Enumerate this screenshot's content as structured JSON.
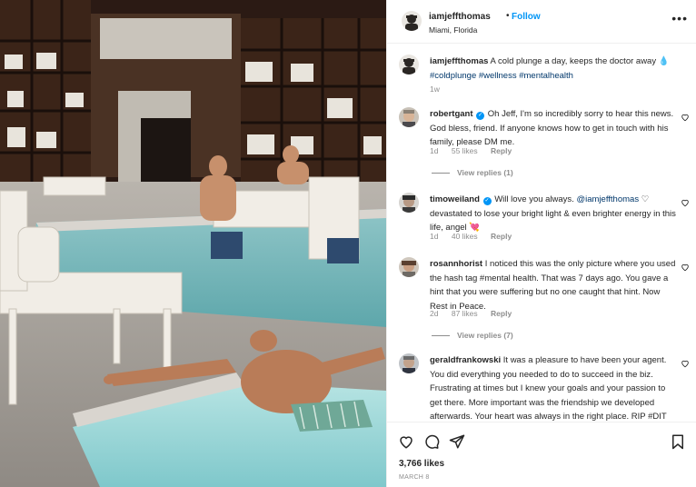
{
  "post": {
    "author": "iamjeffthomas",
    "follow_label": "Follow",
    "location": "Miami, Florida",
    "more_icon": "more-horizontal-icon"
  },
  "caption": {
    "username": "iamjeffthomas",
    "text": "A cold plunge a day, keeps the doctor away",
    "emoji": "💧",
    "hashtags": "#coldplunge #wellness #mentalhealth",
    "time": "1w"
  },
  "comments": [
    {
      "username": "robertgant",
      "verified": true,
      "text": "Oh Jeff, I'm so incredibly sorry to hear this news. God bless, friend. If anyone knows how to get in touch with his family, please DM me.",
      "time": "1d",
      "likes": "55 likes",
      "reply": "Reply",
      "view_replies": "View replies (1)"
    },
    {
      "username": "timoweiland",
      "verified": true,
      "text_before": "Will love you always.",
      "mention": "@iamjeffthomas",
      "emoji1": "♡",
      "text_after": "devastated to lose your bright light & even brighter energy in this life, angel",
      "emoji2": "💘",
      "time": "1d",
      "likes": "40 likes",
      "reply": "Reply"
    },
    {
      "username": "rosannhorist",
      "verified": false,
      "text": "I noticed this was the only picture where you used the hash tag #mental health. That was 7 days ago. You gave a hint that you were suffering but no one caught that hint. Now Rest in Peace.",
      "time": "2d",
      "likes": "87 likes",
      "reply": "Reply",
      "view_replies": "View replies (7)"
    },
    {
      "username": "geraldfrankowski",
      "verified": false,
      "text": "It was a pleasure to have been your agent. You did everything you needed to do to succeed in the biz. Frustrating at times but I knew your goals and your passion to get there. More important was the friendship we developed afterwards. Your heart was always in the right place. RIP #DIT"
    }
  ],
  "footer": {
    "likes": "3,766 likes",
    "date": "MARCH 8",
    "icons": [
      "heart-icon",
      "comment-icon",
      "share-icon",
      "bookmark-icon"
    ]
  },
  "colors": {
    "accent": "#0095f6",
    "hashtag": "#00376b",
    "muted": "#8e8e8e",
    "text": "#262626"
  }
}
